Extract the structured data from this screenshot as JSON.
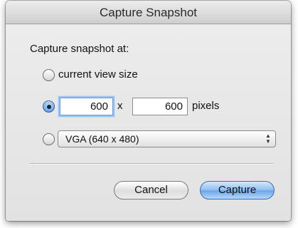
{
  "window": {
    "title": "Capture Snapshot"
  },
  "form": {
    "heading": "Capture snapshot at:",
    "options": {
      "current_view": {
        "label": "current view size",
        "selected": false
      },
      "custom": {
        "selected": true,
        "width": "600",
        "height": "600",
        "times": "x",
        "unit": "pixels"
      },
      "preset": {
        "selected": false,
        "value": "VGA (640 x 480)"
      }
    }
  },
  "buttons": {
    "cancel": "Cancel",
    "capture": "Capture"
  }
}
